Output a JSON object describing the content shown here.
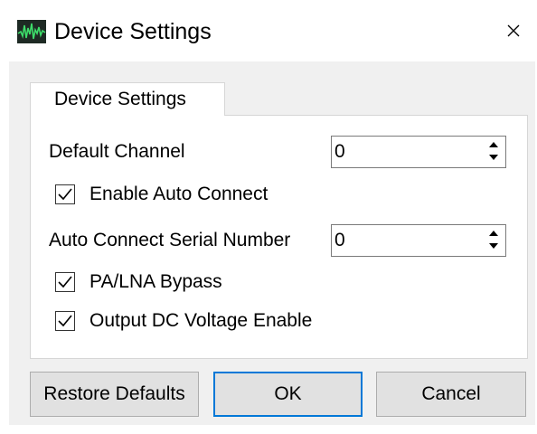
{
  "window": {
    "title": "Device Settings",
    "icon": "waveform-app-icon",
    "close_glyph": "×"
  },
  "tab": {
    "label": "Device Settings"
  },
  "settings": {
    "default_channel": {
      "label": "Default Channel",
      "value": "0"
    },
    "enable_auto_connect": {
      "label": "Enable Auto Connect",
      "checked": true
    },
    "auto_connect_serial": {
      "label": "Auto Connect Serial Number",
      "value": "0"
    },
    "pa_lna_bypass": {
      "label": "PA/LNA Bypass",
      "checked": true
    },
    "output_dc_voltage": {
      "label": "Output DC Voltage Enable",
      "checked": true
    }
  },
  "buttons": {
    "restore_defaults": "Restore Defaults",
    "ok": "OK",
    "cancel": "Cancel"
  },
  "colors": {
    "client_background": "#f0f0f0",
    "default_button_border": "#0078d7",
    "app_icon_background": "#1e2a24",
    "app_icon_wave": "#3ddc6a"
  }
}
